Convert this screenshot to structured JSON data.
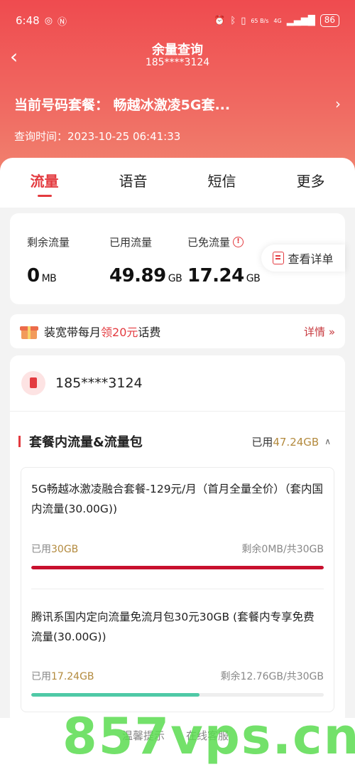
{
  "status_bar": {
    "time": "6:48",
    "net_speed": "65 B/s",
    "network": "4G",
    "battery": "86"
  },
  "header": {
    "title": "余量查询",
    "phone": "185****3124",
    "plan_label": "当前号码套餐：",
    "plan_name": "畅越冰激凌5G套...",
    "query_time": "查询时间：2023-10-25 06:41:33"
  },
  "tabs": [
    {
      "label": "流量",
      "active": true
    },
    {
      "label": "语音",
      "active": false
    },
    {
      "label": "短信",
      "active": false
    },
    {
      "label": "更多",
      "active": false
    }
  ],
  "summary": {
    "remaining": {
      "label": "剩余流量",
      "value": "0",
      "unit": "MB"
    },
    "used": {
      "label": "已用流量",
      "value": "49.89",
      "unit": "GB"
    },
    "free": {
      "label": "已免流量",
      "value": "17.24",
      "unit": "GB"
    },
    "detail_button": "查看详单"
  },
  "promo": {
    "text_before": "装宽带每月",
    "highlight": "领20元",
    "text_after": "话费",
    "more": "详情"
  },
  "card": {
    "phone": "185****3124",
    "section_title": "套餐内流量&流量包",
    "used_prefix": "已用",
    "used_value": "47.24GB",
    "packages": [
      {
        "name": "5G畅越冰激凌融合套餐-129元/月（首月全量全价）（套内国内流量(30.00G))",
        "used_prefix": "已用",
        "used": "30GB",
        "remaining": "剩余0MB/共30GB",
        "fraction": 1.0,
        "color": "#c8102e"
      },
      {
        "name": "腾讯系国内定向流量免流月包30元30GB (套餐内专享免费流量(30.00G))",
        "used_prefix": "已用",
        "used": "17.24GB",
        "remaining": "剩余12.76GB/共30GB",
        "fraction": 0.575,
        "color": "#4fc9a6"
      }
    ]
  },
  "footer": {
    "tips": "温馨提示",
    "service": "在线客服"
  },
  "watermark": "857vps.cn"
}
